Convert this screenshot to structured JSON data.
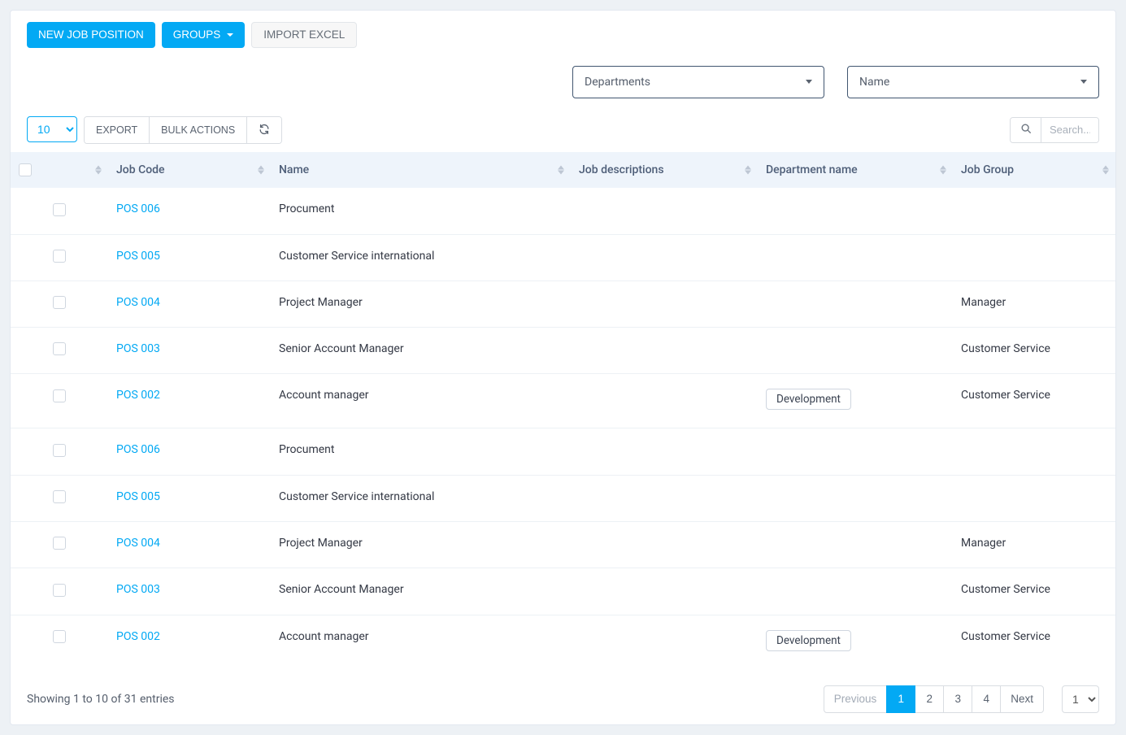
{
  "toolbar": {
    "new_label": "NEW JOB POSITION",
    "groups_label": "GROUPS",
    "import_label": "IMPORT EXCEL"
  },
  "filters": {
    "departments_label": "Departments",
    "name_label": "Name"
  },
  "tools": {
    "page_len": "10",
    "export_label": "EXPORT",
    "bulk_label": "BULK ACTIONS",
    "search_placeholder": "Search..."
  },
  "columns": {
    "code": "Job Code",
    "name": "Name",
    "desc": "Job descriptions",
    "dept": "Department name",
    "group": "Job Group"
  },
  "rows": [
    {
      "code": "POS 006",
      "name": "Procument",
      "desc": "",
      "dept": "",
      "group": ""
    },
    {
      "code": "POS 005",
      "name": "Customer Service international",
      "desc": "",
      "dept": "",
      "group": ""
    },
    {
      "code": "POS 004",
      "name": "Project Manager",
      "desc": "",
      "dept": "",
      "group": "Manager"
    },
    {
      "code": "POS 003",
      "name": "Senior Account Manager",
      "desc": "",
      "dept": "",
      "group": "Customer Service"
    },
    {
      "code": "POS 002",
      "name": "Account manager",
      "desc": "",
      "dept": "Development",
      "group": "Customer Service"
    },
    {
      "code": "POS 006",
      "name": "Procument",
      "desc": "",
      "dept": "",
      "group": ""
    },
    {
      "code": "POS 005",
      "name": "Customer Service international",
      "desc": "",
      "dept": "",
      "group": ""
    },
    {
      "code": "POS 004",
      "name": "Project Manager",
      "desc": "",
      "dept": "",
      "group": "Manager"
    },
    {
      "code": "POS 003",
      "name": "Senior Account Manager",
      "desc": "",
      "dept": "",
      "group": "Customer Service"
    },
    {
      "code": "POS 002",
      "name": "Account manager",
      "desc": "",
      "dept": "Development",
      "group": "Customer Service"
    }
  ],
  "footer": {
    "entries_info": "Showing 1 to 10 of 31 entries",
    "prev_label": "Previous",
    "next_label": "Next",
    "pages": [
      "1",
      "2",
      "3",
      "4"
    ],
    "active_page": "1",
    "goto_value": "1"
  }
}
